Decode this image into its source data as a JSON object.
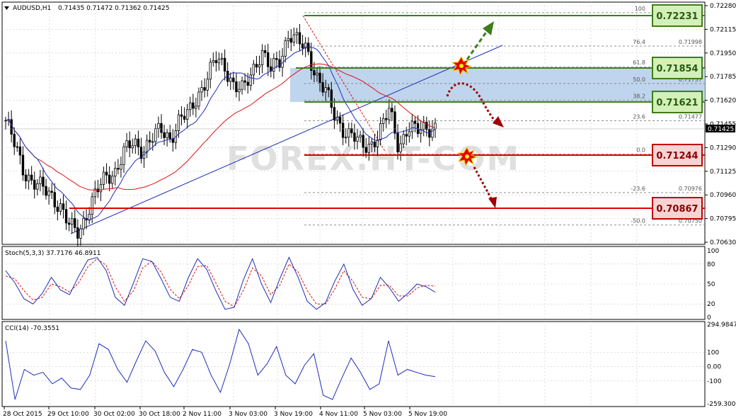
{
  "header": {
    "symbol": "AUDUSD,H1",
    "ohlc": "0.71435 0.71472 0.71362 0.71425"
  },
  "watermark": "FOREX.HT-COM",
  "colors": {
    "grid": "#c8c8c8",
    "candle": "#000000",
    "ma_fast": "#1f2fb8",
    "ma_slow": "#e01010",
    "fib": "#808080",
    "green_level": "#3e7d1a",
    "red_level": "#e00000",
    "zone": "#b8d0ec",
    "stoch_main": "#1f2fb8",
    "stoch_signal": "#e01010",
    "cci": "#1f2fb8"
  },
  "chart_data": [
    {
      "type": "candlestick",
      "title": "AUDUSD,H1",
      "ylim": [
        0.7063,
        0.7228
      ],
      "price_labels": [
        "0.72280",
        "0.72115",
        "0.71950",
        "0.71785",
        "0.71620",
        "0.71455",
        "0.71290",
        "0.71125",
        "0.70960",
        "0.70795",
        "0.70630"
      ],
      "current_price": "0.71425",
      "x_labels": [
        "28 Oct 2015",
        "29 Oct 10:00",
        "30 Oct 02:00",
        "30 Oct 18:00",
        "2 Nov 11:00",
        "3 Nov 03:00",
        "3 Nov 19:00",
        "4 Nov 11:00",
        "5 Nov 03:00",
        "5 Nov 19:00"
      ],
      "close_path": [
        0.7148,
        0.713,
        0.7113,
        0.7105,
        0.71,
        0.7096,
        0.7088,
        0.7073,
        0.707,
        0.7086,
        0.7098,
        0.7109,
        0.7113,
        0.7126,
        0.7132,
        0.7128,
        0.7135,
        0.7141,
        0.7136,
        0.7148,
        0.7152,
        0.7166,
        0.7177,
        0.719,
        0.7186,
        0.7172,
        0.7168,
        0.7183,
        0.7197,
        0.7182,
        0.719,
        0.721,
        0.7202,
        0.7196,
        0.718,
        0.7168,
        0.715,
        0.7142,
        0.7137,
        0.7129,
        0.7132,
        0.7141,
        0.7155,
        0.713,
        0.7143,
        0.714,
        0.7144,
        0.7143
      ],
      "fibonacci": [
        {
          "level": "100",
          "price": "0.72231"
        },
        {
          "level": "76.4",
          "price": "0.71998"
        },
        {
          "level": "61.8",
          "price": "0.71854"
        },
        {
          "level": "50.0",
          "price": "0.71737"
        },
        {
          "level": "38.2",
          "price": "0.71621"
        },
        {
          "level": "23.6",
          "price": "0.71477"
        },
        {
          "level": "0.0",
          "price": "0.71244"
        },
        {
          "level": "-23.6",
          "price": "0.70976"
        },
        {
          "level": "-50.0",
          "price": "0.70750"
        }
      ],
      "levels": [
        {
          "name": "resistance-top",
          "price": "0.72231",
          "color": "green"
        },
        {
          "name": "resistance-mid",
          "price": "0.71854",
          "color": "green"
        },
        {
          "name": "resistance-low",
          "price": "0.71621",
          "color": "green"
        },
        {
          "name": "support-high",
          "price": "0.71244",
          "color": "red"
        },
        {
          "name": "support-low",
          "price": "0.70867",
          "color": "red"
        }
      ]
    },
    {
      "type": "line",
      "title": "Stoch(5,3,3) 37.7176 46.8911",
      "ylim": [
        0,
        100
      ],
      "y_labels": [
        "100",
        "80",
        "50",
        "20",
        "0"
      ],
      "series": [
        {
          "values": [
            70,
            52,
            28,
            20,
            36,
            60,
            41,
            34,
            62,
            86,
            90,
            70,
            30,
            18,
            52,
            88,
            84,
            58,
            30,
            24,
            60,
            88,
            72,
            40,
            12,
            15,
            56,
            88,
            50,
            22,
            58,
            90,
            60,
            24,
            12,
            22,
            54,
            80,
            42,
            18,
            28,
            60,
            44,
            24,
            36,
            50,
            46,
            37.7
          ]
        },
        {
          "values": [
            62,
            58,
            40,
            26,
            30,
            50,
            46,
            38,
            52,
            76,
            88,
            78,
            46,
            24,
            40,
            74,
            84,
            68,
            42,
            28,
            48,
            76,
            78,
            52,
            24,
            16,
            40,
            74,
            62,
            34,
            48,
            80,
            68,
            40,
            20,
            20,
            42,
            70,
            54,
            30,
            28,
            48,
            48,
            32,
            32,
            44,
            48,
            46.9
          ]
        }
      ]
    },
    {
      "type": "line",
      "title": "CCI(14) -70.3551",
      "ylim": [
        -259.3005,
        294.9847
      ],
      "y_labels": [
        "294.9847",
        "100",
        "0.00",
        "-100",
        "-259.3005"
      ],
      "series": [
        {
          "values": [
            180,
            -230,
            -20,
            -60,
            -40,
            -120,
            -80,
            -150,
            -160,
            -60,
            160,
            120,
            -20,
            -110,
            40,
            180,
            110,
            -40,
            -140,
            -20,
            120,
            100,
            -60,
            -180,
            20,
            260,
            160,
            -60,
            20,
            140,
            -60,
            -120,
            10,
            90,
            -200,
            -230,
            -80,
            60,
            -40,
            -160,
            -120,
            180,
            -60,
            -20,
            -40,
            -60,
            -70.4
          ]
        }
      ]
    }
  ]
}
